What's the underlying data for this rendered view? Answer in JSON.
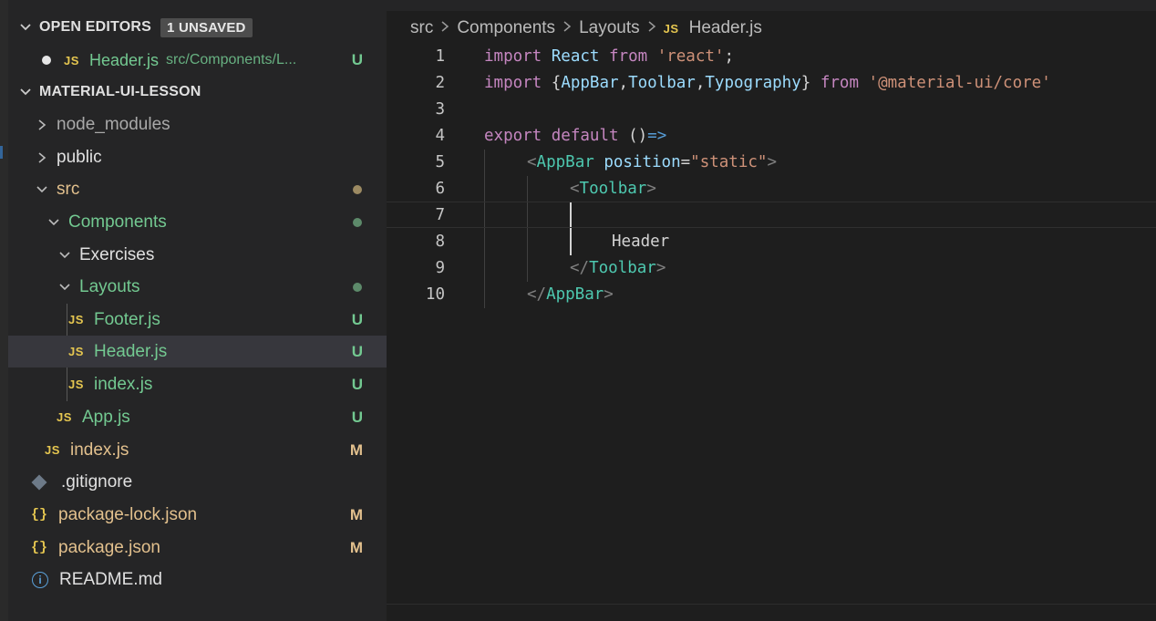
{
  "open_editors": {
    "title": "OPEN EDITORS",
    "badge": "1 UNSAVED",
    "items": [
      {
        "icon": "JS",
        "name": "Header.js",
        "path": "src/Components/L...",
        "git": "U"
      }
    ]
  },
  "explorer": {
    "title": "MATERIAL-UI-LESSON",
    "tree": [
      {
        "label": "node_modules",
        "git": ""
      },
      {
        "label": "public",
        "git": ""
      },
      {
        "label": "src",
        "git": ""
      },
      {
        "label": "Components",
        "git": ""
      },
      {
        "label": "Exercises",
        "git": ""
      },
      {
        "label": "Layouts",
        "git": ""
      },
      {
        "icon": "JS",
        "label": "Footer.js",
        "git": "U"
      },
      {
        "icon": "JS",
        "label": "Header.js",
        "git": "U"
      },
      {
        "icon": "JS",
        "label": "index.js",
        "git": "U"
      },
      {
        "icon": "JS",
        "label": "App.js",
        "git": "U"
      },
      {
        "icon": "JS",
        "label": "index.js",
        "git": "M"
      },
      {
        "label": ".gitignore",
        "git": ""
      },
      {
        "icon": "{}",
        "label": "package-lock.json",
        "git": "M"
      },
      {
        "icon": "{}",
        "label": "package.json",
        "git": "M"
      },
      {
        "icon": "i",
        "label": "README.md",
        "git": ""
      }
    ]
  },
  "breadcrumb": {
    "parts": [
      "src",
      "Components",
      "Layouts"
    ],
    "file_icon": "JS",
    "file": "Header.js"
  },
  "code": {
    "line_numbers": [
      "1",
      "2",
      "3",
      "4",
      "5",
      "6",
      "7",
      "8",
      "9",
      "10"
    ],
    "l1": {
      "kw1": "import",
      "id": "React",
      "kw2": "from",
      "str": "'react'",
      "end": ";"
    },
    "l2": {
      "kw1": "import",
      "open": "{",
      "a": "AppBar",
      "c1": ",",
      "b": "Toolbar",
      "c2": ",",
      "c": "Typography",
      "close": "}",
      "kw2": "from",
      "str": "'@material-ui/core'"
    },
    "l4": {
      "kw1": "export",
      "kw2": "default",
      "parens": "()",
      "arrow": "=>"
    },
    "l5": {
      "lt": "<",
      "tag": "AppBar",
      "attr": "position",
      "eq": "=",
      "val": "\"static\"",
      "gt": ">"
    },
    "l6": {
      "lt": "<",
      "tag": "Toolbar",
      "gt": ">"
    },
    "l8": {
      "text": "Header"
    },
    "l9": {
      "lt": "</",
      "tag": "Toolbar",
      "gt": ">"
    },
    "l10": {
      "lt": "</",
      "tag": "AppBar",
      "gt": ">"
    }
  }
}
